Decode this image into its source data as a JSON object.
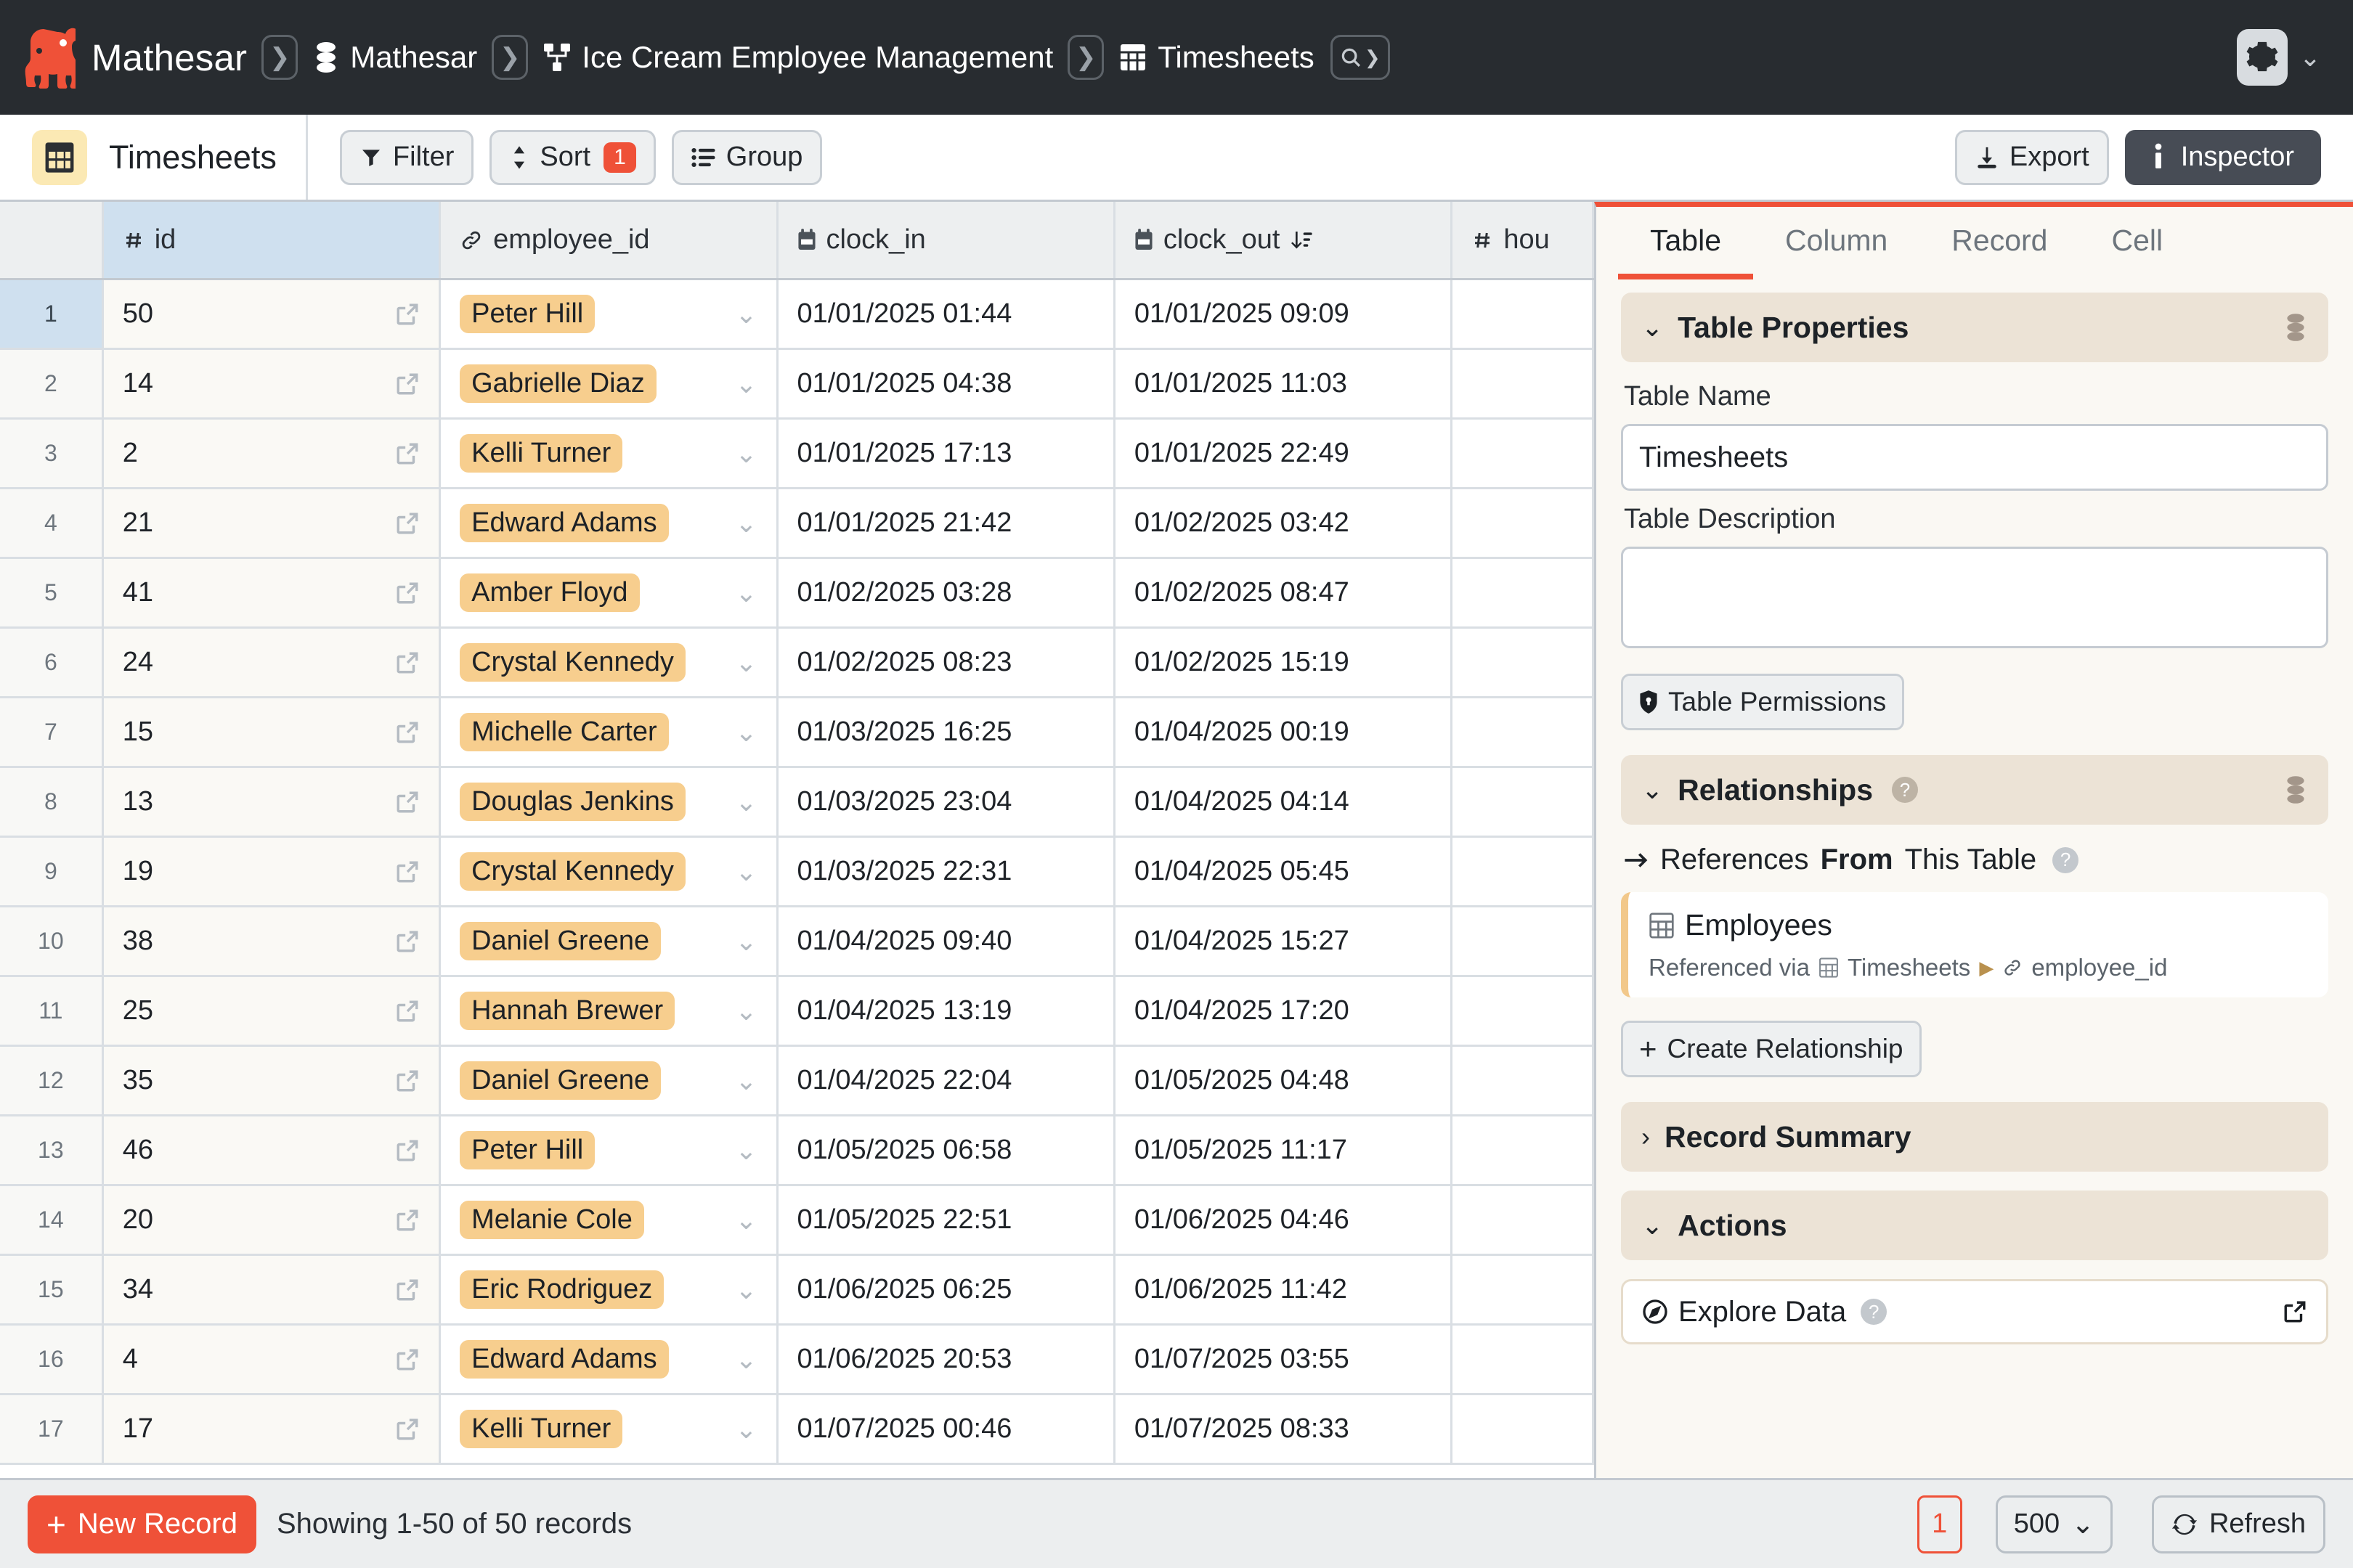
{
  "topbar": {
    "brand": "Mathesar",
    "breadcrumbs": [
      {
        "label": "Mathesar",
        "icon": "database-icon"
      },
      {
        "label": "Ice Cream Employee Management",
        "icon": "schema-icon"
      },
      {
        "label": "Timesheets",
        "icon": "table-icon"
      }
    ],
    "search_icon": "search-icon",
    "settings_icon": "gear-icon",
    "settings_caret": "⌄"
  },
  "toolbar": {
    "table_name": "Timesheets",
    "table_icon": "table-icon",
    "filter_label": "Filter",
    "sort_label": "Sort",
    "sort_count": "1",
    "group_label": "Group",
    "export_label": "Export",
    "inspector_label": "Inspector"
  },
  "grid": {
    "columns": [
      {
        "key": "rownum",
        "label": "",
        "icon": ""
      },
      {
        "key": "id",
        "label": "id",
        "icon": "number-icon",
        "selected": true
      },
      {
        "key": "employee_id",
        "label": "employee_id",
        "icon": "link-icon"
      },
      {
        "key": "clock_in",
        "label": "clock_in",
        "icon": "calendar-icon"
      },
      {
        "key": "clock_out",
        "label": "clock_out",
        "icon": "calendar-icon",
        "sort": "sort-asc-icon"
      },
      {
        "key": "hours",
        "label": "hou",
        "icon": "number-icon"
      }
    ],
    "rows": [
      {
        "n": "1",
        "id": "50",
        "employee": "Peter Hill",
        "clock_in": "01/01/2025 01:44",
        "clock_out": "01/01/2025 09:09",
        "hours": ""
      },
      {
        "n": "2",
        "id": "14",
        "employee": "Gabrielle Diaz",
        "clock_in": "01/01/2025 04:38",
        "clock_out": "01/01/2025 11:03",
        "hours": ""
      },
      {
        "n": "3",
        "id": "2",
        "employee": "Kelli Turner",
        "clock_in": "01/01/2025 17:13",
        "clock_out": "01/01/2025 22:49",
        "hours": ""
      },
      {
        "n": "4",
        "id": "21",
        "employee": "Edward Adams",
        "clock_in": "01/01/2025 21:42",
        "clock_out": "01/02/2025 03:42",
        "hours": ""
      },
      {
        "n": "5",
        "id": "41",
        "employee": "Amber Floyd",
        "clock_in": "01/02/2025 03:28",
        "clock_out": "01/02/2025 08:47",
        "hours": ""
      },
      {
        "n": "6",
        "id": "24",
        "employee": "Crystal Kennedy",
        "clock_in": "01/02/2025 08:23",
        "clock_out": "01/02/2025 15:19",
        "hours": ""
      },
      {
        "n": "7",
        "id": "15",
        "employee": "Michelle Carter",
        "clock_in": "01/03/2025 16:25",
        "clock_out": "01/04/2025 00:19",
        "hours": ""
      },
      {
        "n": "8",
        "id": "13",
        "employee": "Douglas Jenkins",
        "clock_in": "01/03/2025 23:04",
        "clock_out": "01/04/2025 04:14",
        "hours": ""
      },
      {
        "n": "9",
        "id": "19",
        "employee": "Crystal Kennedy",
        "clock_in": "01/03/2025 22:31",
        "clock_out": "01/04/2025 05:45",
        "hours": ""
      },
      {
        "n": "10",
        "id": "38",
        "employee": "Daniel Greene",
        "clock_in": "01/04/2025 09:40",
        "clock_out": "01/04/2025 15:27",
        "hours": ""
      },
      {
        "n": "11",
        "id": "25",
        "employee": "Hannah Brewer",
        "clock_in": "01/04/2025 13:19",
        "clock_out": "01/04/2025 17:20",
        "hours": ""
      },
      {
        "n": "12",
        "id": "35",
        "employee": "Daniel Greene",
        "clock_in": "01/04/2025 22:04",
        "clock_out": "01/05/2025 04:48",
        "hours": ""
      },
      {
        "n": "13",
        "id": "46",
        "employee": "Peter Hill",
        "clock_in": "01/05/2025 06:58",
        "clock_out": "01/05/2025 11:17",
        "hours": ""
      },
      {
        "n": "14",
        "id": "20",
        "employee": "Melanie Cole",
        "clock_in": "01/05/2025 22:51",
        "clock_out": "01/06/2025 04:46",
        "hours": ""
      },
      {
        "n": "15",
        "id": "34",
        "employee": "Eric Rodriguez",
        "clock_in": "01/06/2025 06:25",
        "clock_out": "01/06/2025 11:42",
        "hours": ""
      },
      {
        "n": "16",
        "id": "4",
        "employee": "Edward Adams",
        "clock_in": "01/06/2025 20:53",
        "clock_out": "01/07/2025 03:55",
        "hours": ""
      },
      {
        "n": "17",
        "id": "17",
        "employee": "Kelli Turner",
        "clock_in": "01/07/2025 00:46",
        "clock_out": "01/07/2025 08:33",
        "hours": ""
      }
    ]
  },
  "inspector": {
    "tabs": [
      {
        "label": "Table",
        "active": true
      },
      {
        "label": "Column",
        "active": false
      },
      {
        "label": "Record",
        "active": false
      },
      {
        "label": "Cell",
        "active": false
      }
    ],
    "table_properties": {
      "section_title": "Table Properties",
      "collapse_glyph": "⌄",
      "name_label": "Table Name",
      "name_value": "Timesheets",
      "description_label": "Table Description",
      "description_value": "",
      "description_placeholder": "",
      "permissions_label": "Table Permissions"
    },
    "relationships": {
      "section_title": "Relationships",
      "collapse_glyph": "⌄",
      "help_glyph": "?",
      "refs_from_prefix": "References",
      "refs_from_bold": "From",
      "refs_from_suffix": "This Table",
      "card": {
        "table": "Employees",
        "sub_prefix": "Referenced via",
        "sub_table": "Timesheets",
        "sub_arrow": "▶",
        "sub_column": "employee_id"
      },
      "create_label": "Create Relationship"
    },
    "record_summary": {
      "section_title": "Record Summary",
      "collapse_glyph": "›"
    },
    "actions": {
      "section_title": "Actions",
      "collapse_glyph": "⌄",
      "explore_label": "Explore Data",
      "help_glyph": "?"
    }
  },
  "footer": {
    "new_record_label": "New Record",
    "showing_text": "Showing 1-50 of 50 records",
    "page_number": "1",
    "page_size": "500",
    "page_size_caret": "⌄",
    "refresh_label": "Refresh"
  },
  "colors": {
    "accent": "#ef5138",
    "topbar_bg": "#282c30",
    "pill": "#f7ce8e",
    "selected_col": "#cfe0ef",
    "section_bg": "#ece3d6",
    "panel_bg": "#faf8f3"
  }
}
